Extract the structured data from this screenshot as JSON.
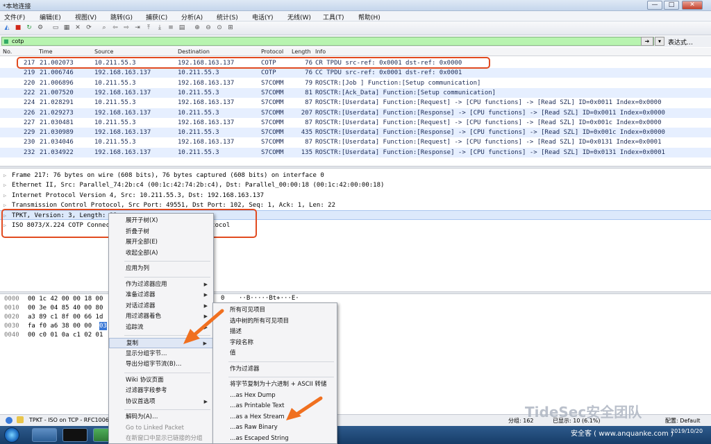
{
  "window": {
    "title": "*本地连接"
  },
  "window_controls": {
    "minimize": "—",
    "maximize": "□",
    "close": "✕"
  },
  "menubar": [
    "文件(F)",
    "编辑(E)",
    "视图(V)",
    "跳转(G)",
    "捕获(C)",
    "分析(A)",
    "统计(S)",
    "电话(Y)",
    "无线(W)",
    "工具(T)",
    "帮助(H)"
  ],
  "toolbar_icons": [
    "shark-fin-start-icon",
    "stop-square-icon",
    "restart-icon",
    "options-gear-icon",
    "open-folder-icon",
    "save-icon",
    "close-file-icon",
    "reload-icon",
    "find-icon",
    "back-arrow-icon",
    "forward-arrow-icon",
    "goto-packet-icon",
    "first-packet-icon",
    "last-packet-icon",
    "autoscroll-icon",
    "colorize-icon",
    "zoom-in-icon",
    "zoom-out-icon",
    "zoom-reset-icon",
    "resize-columns-icon"
  ],
  "filter": {
    "value": "cotp",
    "expression_label": "表达式…"
  },
  "columns": {
    "no": "No.",
    "time": "Time",
    "source": "Source",
    "destination": "Destination",
    "protocol": "Protocol",
    "length": "Length",
    "info": "Info"
  },
  "packets": [
    {
      "no": "217",
      "time": "21.002073",
      "src": "10.211.55.3",
      "dst": "192.168.163.137",
      "proto": "COTP",
      "len": "76",
      "info": "CR TPDU src-ref: 0x0001 dst-ref: 0x0000"
    },
    {
      "no": "219",
      "time": "21.006746",
      "src": "192.168.163.137",
      "dst": "10.211.55.3",
      "proto": "COTP",
      "len": "76",
      "info": "CC TPDU src-ref: 0x0001 dst-ref: 0x0001"
    },
    {
      "no": "220",
      "time": "21.006896",
      "src": "10.211.55.3",
      "dst": "192.168.163.137",
      "proto": "S7COMM",
      "len": "79",
      "info": "ROSCTR:[Job      ] Function:[Setup communication]"
    },
    {
      "no": "222",
      "time": "21.007520",
      "src": "192.168.163.137",
      "dst": "10.211.55.3",
      "proto": "S7COMM",
      "len": "81",
      "info": "ROSCTR:[Ack_Data] Function:[Setup communication]"
    },
    {
      "no": "224",
      "time": "21.028291",
      "src": "10.211.55.3",
      "dst": "192.168.163.137",
      "proto": "S7COMM",
      "len": "87",
      "info": "ROSCTR:[Userdata] Function:[Request] -> [CPU functions] -> [Read SZL] ID=0x0011 Index=0x0000"
    },
    {
      "no": "226",
      "time": "21.029273",
      "src": "192.168.163.137",
      "dst": "10.211.55.3",
      "proto": "S7COMM",
      "len": "207",
      "info": "ROSCTR:[Userdata] Function:[Response] -> [CPU functions] -> [Read SZL] ID=0x0011 Index=0x0000"
    },
    {
      "no": "227",
      "time": "21.030481",
      "src": "10.211.55.3",
      "dst": "192.168.163.137",
      "proto": "S7COMM",
      "len": "87",
      "info": "ROSCTR:[Userdata] Function:[Request] -> [CPU functions] -> [Read SZL] ID=0x001c Index=0x0000"
    },
    {
      "no": "229",
      "time": "21.030989",
      "src": "192.168.163.137",
      "dst": "10.211.55.3",
      "proto": "S7COMM",
      "len": "435",
      "info": "ROSCTR:[Userdata] Function:[Response] -> [CPU functions] -> [Read SZL] ID=0x001c Index=0x0000"
    },
    {
      "no": "230",
      "time": "21.034046",
      "src": "10.211.55.3",
      "dst": "192.168.163.137",
      "proto": "S7COMM",
      "len": "87",
      "info": "ROSCTR:[Userdata] Function:[Request] -> [CPU functions] -> [Read SZL] ID=0x0131 Index=0x0001"
    },
    {
      "no": "232",
      "time": "21.034922",
      "src": "192.168.163.137",
      "dst": "10.211.55.3",
      "proto": "S7COMM",
      "len": "135",
      "info": "ROSCTR:[Userdata] Function:[Response] -> [CPU functions] -> [Read SZL] ID=0x0131 Index=0x0001"
    }
  ],
  "details": [
    "Frame 217: 76 bytes on wire (608 bits), 76 bytes captured (608 bits) on interface 0",
    "Ethernet II, Src: Parallel_74:2b:c4 (00:1c:42:74:2b:c4), Dst: Parallel_00:00:18 (00:1c:42:00:00:18)",
    "Internet Protocol Version 4, Src: 10.211.55.3, Dst: 192.168.163.137",
    "Transmission Control Protocol, Src Port: 49551, Dst Port: 102, Seq: 1, Ack: 1, Len: 22",
    "TPKT, Version: 3, Length: 22",
    "ISO 8073/X.224 COTP Connection-Oriented Transport Protocol"
  ],
  "bytes": [
    {
      "off": "0000",
      "hex": "00 1c 42 00 00 18 00",
      "ascii": "··B·····Bt+···E·"
    },
    {
      "off": "0010",
      "hex": "00 3e 04 85 40 00 80",
      "ascii": ""
    },
    {
      "off": "0020",
      "hex": "a3 89 c1 8f 00 66 1d",
      "ascii": ""
    },
    {
      "off": "0030",
      "hex": "fa f0 a6 38 00 00 ",
      "hl": "03",
      "ascii": ""
    },
    {
      "off": "0040",
      "hex": "00 c0 01 0a c1 02 01",
      "ascii": ""
    }
  ],
  "bytes_extra": {
    "col0": "0",
    "ascii0": "··B·····Bt+···E·"
  },
  "context_menu": [
    {
      "label": "展开子树(X)",
      "disabled": false
    },
    {
      "label": "折叠子树",
      "disabled": false
    },
    {
      "label": "展开全部(E)",
      "disabled": false
    },
    {
      "label": "收起全部(A)",
      "disabled": false
    },
    {
      "sep": true
    },
    {
      "label": "应用为列",
      "disabled": false
    },
    {
      "sep": true
    },
    {
      "label": "作为过滤器应用",
      "sub": true
    },
    {
      "label": "准备过滤器",
      "sub": true
    },
    {
      "label": "对话过滤器",
      "sub": true
    },
    {
      "label": "用过滤器着色",
      "sub": true
    },
    {
      "label": "追踪流",
      "sub": true
    },
    {
      "sep": true
    },
    {
      "label": "复制",
      "sub": true,
      "active": true
    },
    {
      "label": "显示分组字节…"
    },
    {
      "label": "导出分组字节流(B)…"
    },
    {
      "sep": true
    },
    {
      "label": "Wiki 协议页面"
    },
    {
      "label": "过滤器字段参考"
    },
    {
      "label": "协议首选项",
      "sub": true
    },
    {
      "sep": true
    },
    {
      "label": "解码为(A)…"
    },
    {
      "label": "Go to Linked Packet",
      "disabled": true
    },
    {
      "label": "在新窗口中显示已链接的分组",
      "disabled": true
    }
  ],
  "submenu": [
    {
      "label": "所有可见项目"
    },
    {
      "label": "选中树的所有可见项目"
    },
    {
      "label": "描述"
    },
    {
      "label": "字段名称"
    },
    {
      "label": "值"
    },
    {
      "sep": true
    },
    {
      "label": "作为过滤器"
    },
    {
      "sep": true
    },
    {
      "label": "将字节复制为十六进制 + ASCII 转储"
    },
    {
      "label": "…as Hex Dump"
    },
    {
      "label": "…as Printable Text"
    },
    {
      "label": "…as a Hex Stream"
    },
    {
      "label": "…as Raw Binary"
    },
    {
      "label": "…as Escaped String"
    }
  ],
  "statusbar": {
    "left": "TPKT - ISO on TCP - RFC1006",
    "packets": "分组: 162",
    "displayed": "已显示: 10 (6.1%)",
    "profile": "配置: Default"
  },
  "taskbar": {
    "time": "",
    "date": "2019/10/20",
    "watermark_site": "安全客 ( www.anquanke.com )"
  },
  "watermark": "TideSec安全团队",
  "colors": {
    "highlight_box": "#e14a1f",
    "annotation_arrow": "#f07020",
    "filter_bg": "#b8f4b0",
    "row_alt": "#e6efff"
  }
}
